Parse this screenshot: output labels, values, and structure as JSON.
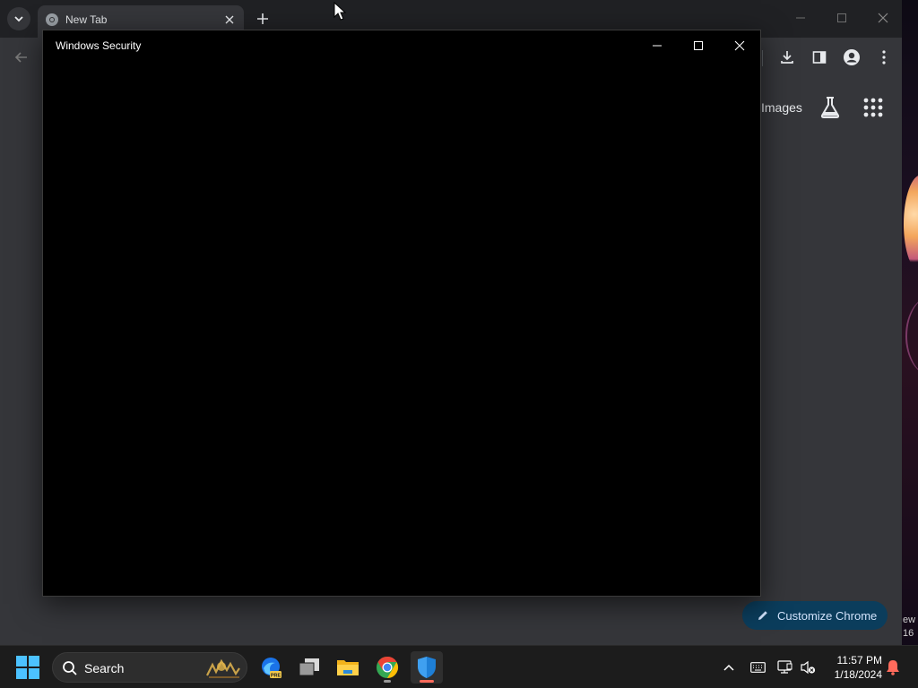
{
  "chrome": {
    "tab_title": "New Tab",
    "images_link": "Images",
    "customize_label": "Customize Chrome",
    "icons": {
      "tab_search": "chevron-down-icon",
      "favicon": "chrome-icon",
      "tab_close": "close-icon",
      "new_tab": "plus-icon",
      "back": "arrow-left-icon",
      "download": "download-icon",
      "side_panel": "side-panel-icon",
      "profile": "profile-icon",
      "menu": "more-vert-icon",
      "labs": "flask-icon",
      "apps": "apps-grid-icon",
      "customize": "pencil-icon"
    }
  },
  "security_window": {
    "title": "Windows Security"
  },
  "desktop": {
    "partial_text_1": "ew",
    "partial_text_2": "16"
  },
  "taskbar": {
    "search_label": "Search",
    "apps": [
      "edge-dev-icon",
      "task-view-icon",
      "file-explorer-icon",
      "chrome-icon",
      "windows-security-icon"
    ],
    "time": "11:57 PM",
    "date": "1/18/2024"
  },
  "colors": {
    "accent_blue": "#4cc2ff",
    "customize_bg": "#0b3d5c",
    "active_indicator": "#ff6b5c"
  }
}
